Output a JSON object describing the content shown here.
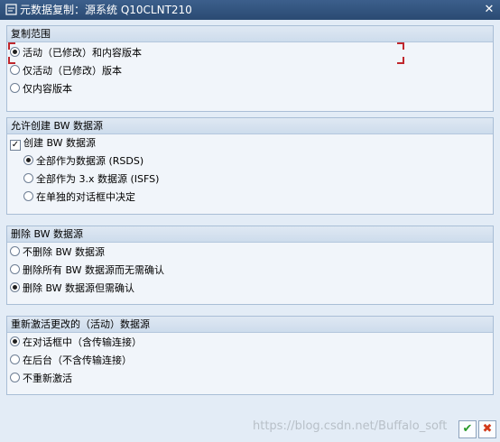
{
  "window": {
    "title": "元数据复制：源系统 Q10CLNT210",
    "close_symbol": "✕"
  },
  "groups": {
    "copy_scope": {
      "title": "复制范围",
      "options": [
        "活动（已修改）和内容版本",
        "仅活动（已修改）版本",
        "仅内容版本"
      ],
      "selected": 0
    },
    "allow_create": {
      "title": "允许创建 BW 数据源",
      "checkbox_label": "创建 BW 数据源",
      "checkbox_checked": true,
      "check_mark": "✓",
      "options": [
        "全部作为数据源 (RSDS)",
        "全部作为 3.x 数据源 (ISFS)",
        "在单独的对话框中决定"
      ],
      "selected": 0
    },
    "delete": {
      "title": "删除 BW 数据源",
      "options": [
        "不删除 BW 数据源",
        "删除所有 BW 数据源而无需确认",
        "删除 BW 数据源但需确认"
      ],
      "selected": 2
    },
    "reactivate": {
      "title": "重新激活更改的（活动）数据源",
      "options": [
        "在对话框中（含传输连接）",
        "在后台（不含传输连接）",
        "不重新激活"
      ],
      "selected": 0
    }
  },
  "footer": {
    "watermark": "https://blog.csdn.net/Buffalo_soft",
    "ok_symbol": "✔",
    "cancel_symbol": "✖"
  },
  "colors": {
    "titlebar": "#3c5f8c",
    "focus_corners": "#c0272d",
    "ok": "#2a9a2a",
    "cancel": "#d23a1a"
  },
  "icons": {
    "app": "document-icon",
    "close": "close-icon",
    "ok": "confirm-icon",
    "cancel": "cancel-icon"
  }
}
